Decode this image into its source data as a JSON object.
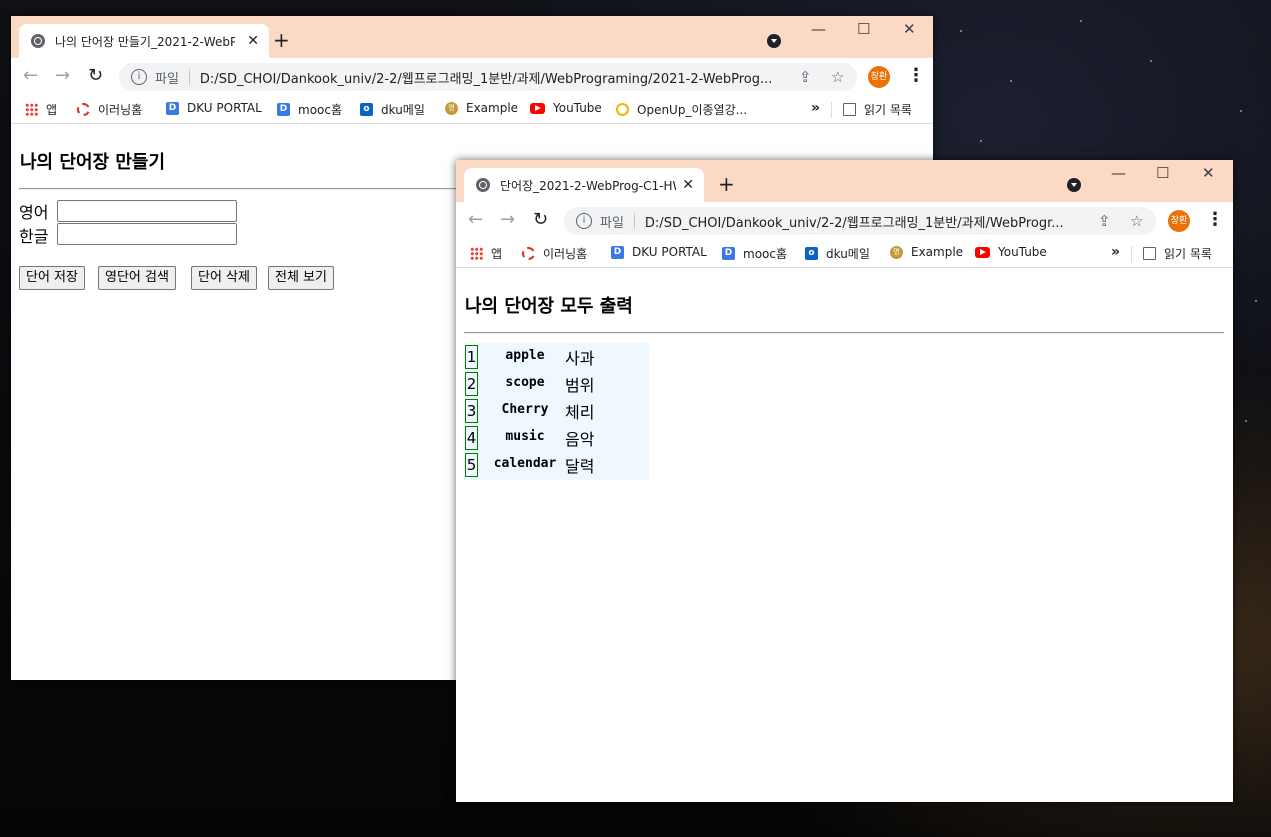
{
  "bookmarks": {
    "apps": "앱",
    "items": [
      "이러닝홈",
      "DKU PORTAL",
      "mooc홈",
      "dku메일",
      "Example",
      "YouTube",
      "OpenUp_이종열강..."
    ],
    "reading_list": "읽기 목록",
    "more": "»"
  },
  "omnibox": {
    "scheme": "파일"
  },
  "avatar_label": "창환",
  "window1": {
    "tab_title": "나의 단어장 만들기_2021-2-WebP",
    "url": "D:/SD_CHOI/Dankook_univ/2-2/웹프로그래밍_1분반/과제/WebPrograming/2021-2-WebProg...",
    "page": {
      "title": "나의 단어장 만들기",
      "english_label": "영어",
      "korean_label": "한글",
      "english_value": "",
      "korean_value": "",
      "buttons": [
        "단어 저장",
        "영단어 검색",
        "단어 삭제",
        "전체 보기"
      ]
    }
  },
  "window2": {
    "tab_title": "단어장_2021-2-WebProg-C1-HW",
    "url": "D:/SD_CHOI/Dankook_univ/2-2/웹프로그래밍_1분반/과제/WebProgr...",
    "page": {
      "title": "나의 단어장 모두 출력",
      "words": [
        {
          "num": "1",
          "eng": "apple",
          "kor": "사과"
        },
        {
          "num": "2",
          "eng": "scope",
          "kor": "범위"
        },
        {
          "num": "3",
          "eng": "Cherry",
          "kor": "체리"
        },
        {
          "num": "4",
          "eng": "music",
          "kor": "음악"
        },
        {
          "num": "5",
          "eng": "calendar",
          "kor": "달력"
        }
      ]
    }
  },
  "colors": {
    "titlebar": "#fcd9c5",
    "word_table_bg": "#f0f8ff",
    "number_border": "#008000",
    "avatar": "#e8710a"
  }
}
